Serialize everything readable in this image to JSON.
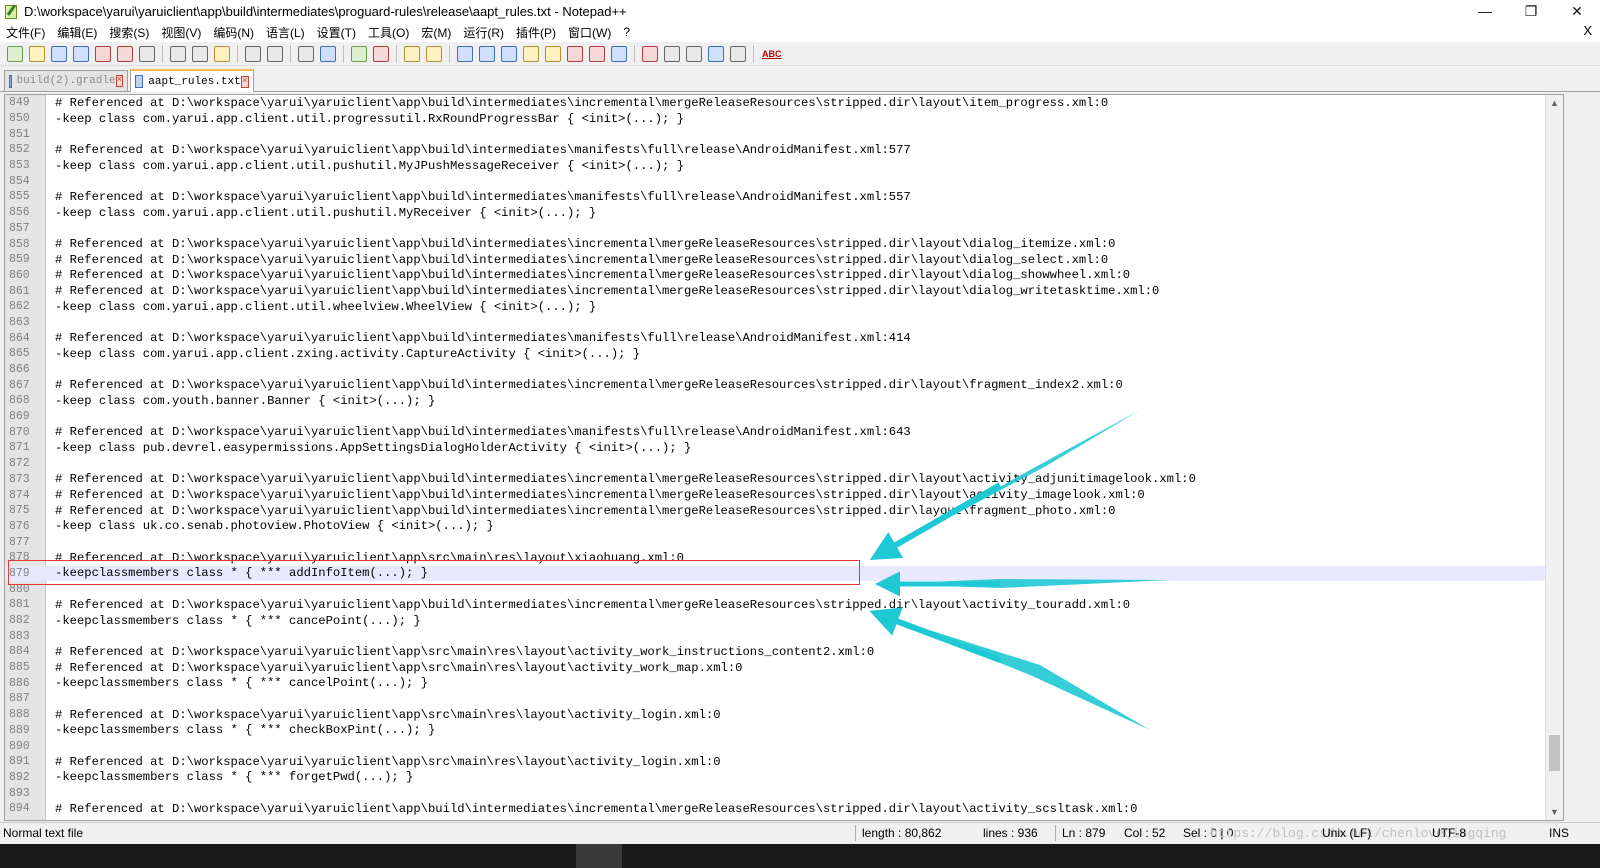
{
  "window": {
    "title": "D:\\workspace\\yarui\\yaruiclient\\app\\build\\intermediates\\proguard-rules\\release\\aapt_rules.txt - Notepad++",
    "minimize": "—",
    "maximize": "❐",
    "close": "✕"
  },
  "menu": {
    "items": [
      "文件(F)",
      "编辑(E)",
      "搜索(S)",
      "视图(V)",
      "编码(N)",
      "语言(L)",
      "设置(T)",
      "工具(O)",
      "宏(M)",
      "运行(R)",
      "插件(P)",
      "窗口(W)",
      "?"
    ],
    "close_doc": "X"
  },
  "toolbar": {
    "abc": "ABC"
  },
  "tabs": [
    {
      "label": "build(2).gradle",
      "active": false
    },
    {
      "label": "aapt_rules.txt",
      "active": true
    }
  ],
  "editor": {
    "current_line": "879",
    "lines": [
      {
        "n": "849",
        "text": "# Referenced at D:\\workspace\\yarui\\yaruiclient\\app\\build\\intermediates\\incremental\\mergeReleaseResources\\stripped.dir\\layout\\item_progress.xml:0"
      },
      {
        "n": "850",
        "text": "-keep class com.yarui.app.client.util.progressutil.RxRoundProgressBar { <init>(...); }"
      },
      {
        "n": "851",
        "text": ""
      },
      {
        "n": "852",
        "text": "# Referenced at D:\\workspace\\yarui\\yaruiclient\\app\\build\\intermediates\\manifests\\full\\release\\AndroidManifest.xml:577"
      },
      {
        "n": "853",
        "text": "-keep class com.yarui.app.client.util.pushutil.MyJPushMessageReceiver { <init>(...); }"
      },
      {
        "n": "854",
        "text": ""
      },
      {
        "n": "855",
        "text": "# Referenced at D:\\workspace\\yarui\\yaruiclient\\app\\build\\intermediates\\manifests\\full\\release\\AndroidManifest.xml:557"
      },
      {
        "n": "856",
        "text": "-keep class com.yarui.app.client.util.pushutil.MyReceiver { <init>(...); }"
      },
      {
        "n": "857",
        "text": ""
      },
      {
        "n": "858",
        "text": "# Referenced at D:\\workspace\\yarui\\yaruiclient\\app\\build\\intermediates\\incremental\\mergeReleaseResources\\stripped.dir\\layout\\dialog_itemize.xml:0"
      },
      {
        "n": "859",
        "text": "# Referenced at D:\\workspace\\yarui\\yaruiclient\\app\\build\\intermediates\\incremental\\mergeReleaseResources\\stripped.dir\\layout\\dialog_select.xml:0"
      },
      {
        "n": "860",
        "text": "# Referenced at D:\\workspace\\yarui\\yaruiclient\\app\\build\\intermediates\\incremental\\mergeReleaseResources\\stripped.dir\\layout\\dialog_showwheel.xml:0"
      },
      {
        "n": "861",
        "text": "# Referenced at D:\\workspace\\yarui\\yaruiclient\\app\\build\\intermediates\\incremental\\mergeReleaseResources\\stripped.dir\\layout\\dialog_writetasktime.xml:0"
      },
      {
        "n": "862",
        "text": "-keep class com.yarui.app.client.util.wheelview.WheelView { <init>(...); }"
      },
      {
        "n": "863",
        "text": ""
      },
      {
        "n": "864",
        "text": "# Referenced at D:\\workspace\\yarui\\yaruiclient\\app\\build\\intermediates\\manifests\\full\\release\\AndroidManifest.xml:414"
      },
      {
        "n": "865",
        "text": "-keep class com.yarui.app.client.zxing.activity.CaptureActivity { <init>(...); }"
      },
      {
        "n": "866",
        "text": ""
      },
      {
        "n": "867",
        "text": "# Referenced at D:\\workspace\\yarui\\yaruiclient\\app\\build\\intermediates\\incremental\\mergeReleaseResources\\stripped.dir\\layout\\fragment_index2.xml:0"
      },
      {
        "n": "868",
        "text": "-keep class com.youth.banner.Banner { <init>(...); }"
      },
      {
        "n": "869",
        "text": ""
      },
      {
        "n": "870",
        "text": "# Referenced at D:\\workspace\\yarui\\yaruiclient\\app\\build\\intermediates\\manifests\\full\\release\\AndroidManifest.xml:643"
      },
      {
        "n": "871",
        "text": "-keep class pub.devrel.easypermissions.AppSettingsDialogHolderActivity { <init>(...); }"
      },
      {
        "n": "872",
        "text": ""
      },
      {
        "n": "873",
        "text": "# Referenced at D:\\workspace\\yarui\\yaruiclient\\app\\build\\intermediates\\incremental\\mergeReleaseResources\\stripped.dir\\layout\\activity_adjunitimagelook.xml:0"
      },
      {
        "n": "874",
        "text": "# Referenced at D:\\workspace\\yarui\\yaruiclient\\app\\build\\intermediates\\incremental\\mergeReleaseResources\\stripped.dir\\layout\\activity_imagelook.xml:0"
      },
      {
        "n": "875",
        "text": "# Referenced at D:\\workspace\\yarui\\yaruiclient\\app\\build\\intermediates\\incremental\\mergeReleaseResources\\stripped.dir\\layout\\fragment_photo.xml:0"
      },
      {
        "n": "876",
        "text": "-keep class uk.co.senab.photoview.PhotoView { <init>(...); }"
      },
      {
        "n": "877",
        "text": ""
      },
      {
        "n": "878",
        "text": "# Referenced at D:\\workspace\\yarui\\yaruiclient\\app\\src\\main\\res\\layout\\xiaohuang.xml:0"
      },
      {
        "n": "879",
        "text": "-keepclassmembers class * { *** addInfoItem(...); }",
        "current": true
      },
      {
        "n": "880",
        "text": ""
      },
      {
        "n": "881",
        "text": "# Referenced at D:\\workspace\\yarui\\yaruiclient\\app\\build\\intermediates\\incremental\\mergeReleaseResources\\stripped.dir\\layout\\activity_touradd.xml:0"
      },
      {
        "n": "882",
        "text": "-keepclassmembers class * { *** cancePoint(...); }"
      },
      {
        "n": "883",
        "text": ""
      },
      {
        "n": "884",
        "text": "# Referenced at D:\\workspace\\yarui\\yaruiclient\\app\\src\\main\\res\\layout\\activity_work_instructions_content2.xml:0"
      },
      {
        "n": "885",
        "text": "# Referenced at D:\\workspace\\yarui\\yaruiclient\\app\\src\\main\\res\\layout\\activity_work_map.xml:0"
      },
      {
        "n": "886",
        "text": "-keepclassmembers class * { *** cancelPoint(...); }"
      },
      {
        "n": "887",
        "text": ""
      },
      {
        "n": "888",
        "text": "# Referenced at D:\\workspace\\yarui\\yaruiclient\\app\\src\\main\\res\\layout\\activity_login.xml:0"
      },
      {
        "n": "889",
        "text": "-keepclassmembers class * { *** checkBoxPint(...); }"
      },
      {
        "n": "890",
        "text": ""
      },
      {
        "n": "891",
        "text": "# Referenced at D:\\workspace\\yarui\\yaruiclient\\app\\src\\main\\res\\layout\\activity_login.xml:0"
      },
      {
        "n": "892",
        "text": "-keepclassmembers class * { *** forgetPwd(...); }"
      },
      {
        "n": "893",
        "text": ""
      },
      {
        "n": "894",
        "text": "# Referenced at D:\\workspace\\yarui\\yaruiclient\\app\\build\\intermediates\\incremental\\mergeReleaseResources\\stripped.dir\\layout\\activity_scsltask.xml:0"
      }
    ]
  },
  "statusbar": {
    "file_type": "Normal text file",
    "length": "length : 80,862",
    "lines": "lines : 936",
    "ln": "Ln : 879",
    "col": "Col : 52",
    "sel": "Sel : 0 | 0",
    "eol": "Unix (LF)",
    "encoding": "UTF-8",
    "mode": "INS",
    "watermark": "https://blog.csdn.net/chenloveQingqing"
  },
  "colors": {
    "annotation_box": "#e53935",
    "annotation_arrow": "#1ec8d4",
    "current_line_bg": "#e8e8ff"
  }
}
